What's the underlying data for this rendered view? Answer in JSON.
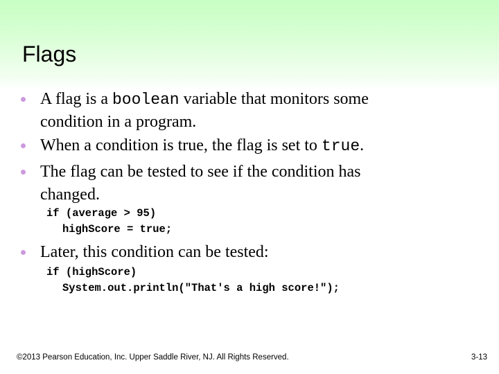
{
  "slide": {
    "title": "Flags",
    "bullets": [
      {
        "line1_pre": "A flag is a ",
        "line1_code": "boolean",
        "line1_post": " variable that monitors some",
        "line2": "condition in a program."
      },
      {
        "line1_pre": "When a condition is true, the flag is set to ",
        "line1_code": "true",
        "line1_post": "."
      },
      {
        "line1": "The flag can be tested to see if the condition has",
        "line2": "changed."
      },
      {
        "line1": "Later, this condition can be tested:"
      }
    ],
    "code_blocks": [
      [
        "if (average > 95)",
        "highScore = true;"
      ],
      [
        "if (highScore)",
        "System.out.println(\"That's a high score!\");"
      ]
    ],
    "footer": {
      "copyright": "©2013 Pearson Education, Inc. Upper Saddle River, NJ. All Rights Reserved.",
      "page_number": "3-13"
    },
    "colors": {
      "bullet": "#cc99dd",
      "header_gradient_top": "#c8ffc4"
    }
  }
}
